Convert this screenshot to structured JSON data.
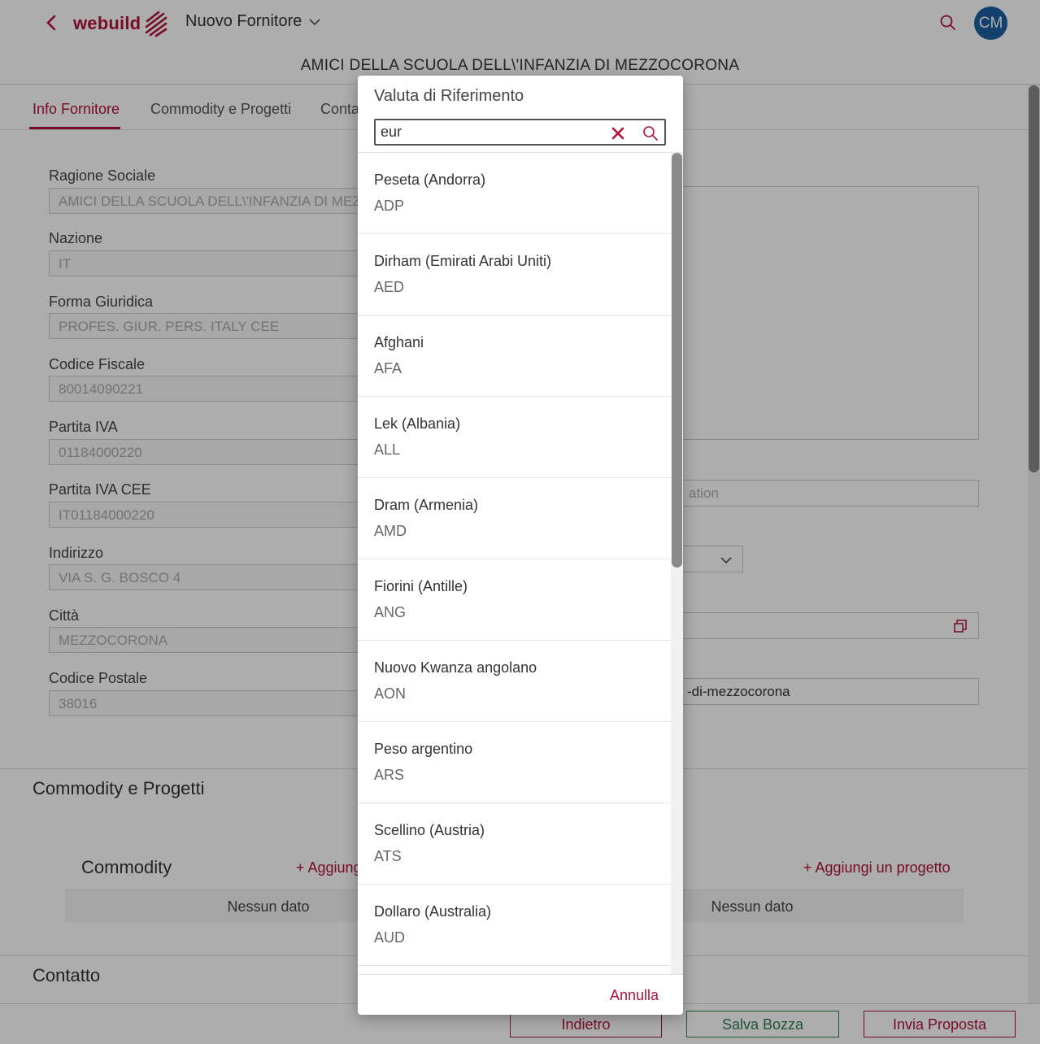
{
  "header": {
    "logo_text": "webuild",
    "app_title": "Nuovo Fornitore",
    "avatar_initials": "CM"
  },
  "supplier_name": "AMICI DELLA SCUOLA DELL\\'INFANZIA DI MEZZOCORONA",
  "tabs": [
    "Info Fornitore",
    "Commodity e Progetti",
    "Conta"
  ],
  "form": {
    "fields": [
      {
        "label": "Ragione Sociale",
        "value": "AMICI DELLA SCUOLA DELL\\'INFANZIA DI MEZZ"
      },
      {
        "label": "Nazione",
        "value": "IT"
      },
      {
        "label": "Forma Giuridica",
        "value": "PROFES. GIUR. PERS. ITALY CEE"
      },
      {
        "label": "Codice Fiscale",
        "value": "80014090221"
      },
      {
        "label": "Partita IVA",
        "value": "01184000220"
      },
      {
        "label": "Partita IVA CEE",
        "value": "IT01184000220"
      },
      {
        "label": "Indirizzo",
        "value": "VIA S. G. BOSCO 4"
      },
      {
        "label": "Città",
        "value": "MEZZOCORONA"
      },
      {
        "label": "Codice Postale",
        "value": "38016"
      }
    ],
    "right_placeholder": "ation",
    "right_url_value": "-di-mezzocorona"
  },
  "sections": {
    "commodity_progetti": "Commodity e Progetti",
    "commodity_title": "Commodity",
    "add_commodity": "+ Aggiung",
    "add_project": "+ Aggiungi un progetto",
    "no_data_left": "Nessun dato",
    "no_data_right": "Nessun dato",
    "contatto": "Contatto"
  },
  "footer": {
    "back": "Indietro",
    "draft": "Salva Bozza",
    "send": "Invia Proposta"
  },
  "modal": {
    "title": "Valuta di Riferimento",
    "search_value": "eur",
    "cancel": "Annulla",
    "items": [
      {
        "name": "Peseta (Andorra)",
        "code": "ADP"
      },
      {
        "name": "Dirham (Emirati Arabi Uniti)",
        "code": "AED"
      },
      {
        "name": "Afghani",
        "code": "AFA"
      },
      {
        "name": "Lek (Albania)",
        "code": "ALL"
      },
      {
        "name": "Dram (Armenia)",
        "code": "AMD"
      },
      {
        "name": "Fiorini (Antille)",
        "code": "ANG"
      },
      {
        "name": "Nuovo Kwanza angolano",
        "code": "AON"
      },
      {
        "name": "Peso argentino",
        "code": "ARS"
      },
      {
        "name": "Scellino (Austria)",
        "code": "ATS"
      },
      {
        "name": "Dollaro (Australia)",
        "code": "AUD"
      }
    ]
  },
  "colors": {
    "brand": "#b0123c",
    "avatar": "#1d5fa0",
    "draft_green": "#2e7d4f"
  },
  "icons": [
    "back-icon",
    "logo-mark-icon",
    "chevron-down-icon",
    "search-icon",
    "clear-icon",
    "copy-icon"
  ]
}
